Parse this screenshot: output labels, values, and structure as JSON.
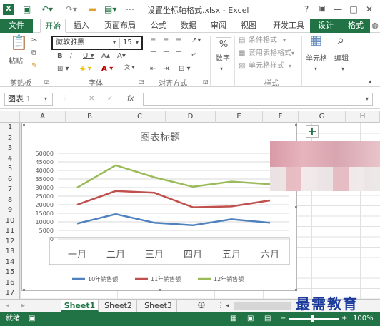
{
  "window": {
    "title": "设置坐标轴格式.xlsx - Excel",
    "help": "?",
    "minimize": "—",
    "restore": "□",
    "close": "✕"
  },
  "quick_access": [
    "save-icon",
    "undo-icon",
    "redo-icon",
    "folder-icon",
    "preview-icon"
  ],
  "tabs": [
    {
      "label": "文件",
      "kind": "file"
    },
    {
      "label": "开始",
      "kind": "active"
    },
    {
      "label": "插入",
      "kind": "normal"
    },
    {
      "label": "页面布局",
      "kind": "normal"
    },
    {
      "label": "公式",
      "kind": "normal"
    },
    {
      "label": "数据",
      "kind": "normal"
    },
    {
      "label": "审阅",
      "kind": "normal"
    },
    {
      "label": "视图",
      "kind": "normal"
    },
    {
      "label": "开发工具",
      "kind": "normal"
    },
    {
      "label": "设计",
      "kind": "ctx"
    },
    {
      "label": "格式",
      "kind": "ctx"
    }
  ],
  "ribbon": {
    "paste_label": "粘贴",
    "font_name": "微软雅黑",
    "font_size": "15",
    "number_btn": "数字",
    "number_symbol": "%",
    "conditional": "条件格式",
    "table_format": "套用表格格式",
    "cell_style": "单元格样式",
    "cells_btn": "单元格",
    "edit_btn": "编辑",
    "groups": {
      "clipboard": "剪贴板",
      "font": "字体",
      "align": "对齐方式",
      "style": "样式"
    }
  },
  "formula_bar": {
    "name_box": "图表 1",
    "fx": "fx"
  },
  "columns": [
    "A",
    "B",
    "C",
    "D",
    "E",
    "F",
    "G",
    "H"
  ],
  "rows": [
    "1",
    "2",
    "3",
    "4",
    "5",
    "6",
    "7",
    "8",
    "9",
    "10",
    "11",
    "12",
    "13",
    "14",
    "15",
    "16",
    "17"
  ],
  "sheets": [
    "Sheet1",
    "Sheet2",
    "Sheet3"
  ],
  "status": {
    "ready": "就绪",
    "zoom": "100%"
  },
  "watermark": "最需教育",
  "chart_data": {
    "type": "line",
    "title": "图表标题",
    "categories": [
      "一月",
      "二月",
      "三月",
      "四月",
      "五月",
      "六月"
    ],
    "y_ticks": [
      "50000",
      "45000",
      "40000",
      "35000",
      "30000",
      "25000",
      "20000",
      "15000",
      "10000",
      "5000",
      "0"
    ],
    "ylim": [
      0,
      50000
    ],
    "legend_position": "bottom",
    "series": [
      {
        "name": "10年销售额",
        "color": "#4f81bd",
        "values": [
          9000,
          14500,
          9500,
          8000,
          11500,
          9500
        ]
      },
      {
        "name": "11年销售额",
        "color": "#c0504d",
        "values": [
          20000,
          28000,
          27000,
          18500,
          19000,
          22500
        ]
      },
      {
        "name": "12年销售额",
        "color": "#9bbb59",
        "values": [
          30000,
          43000,
          36000,
          30500,
          33500,
          32000
        ]
      }
    ]
  }
}
